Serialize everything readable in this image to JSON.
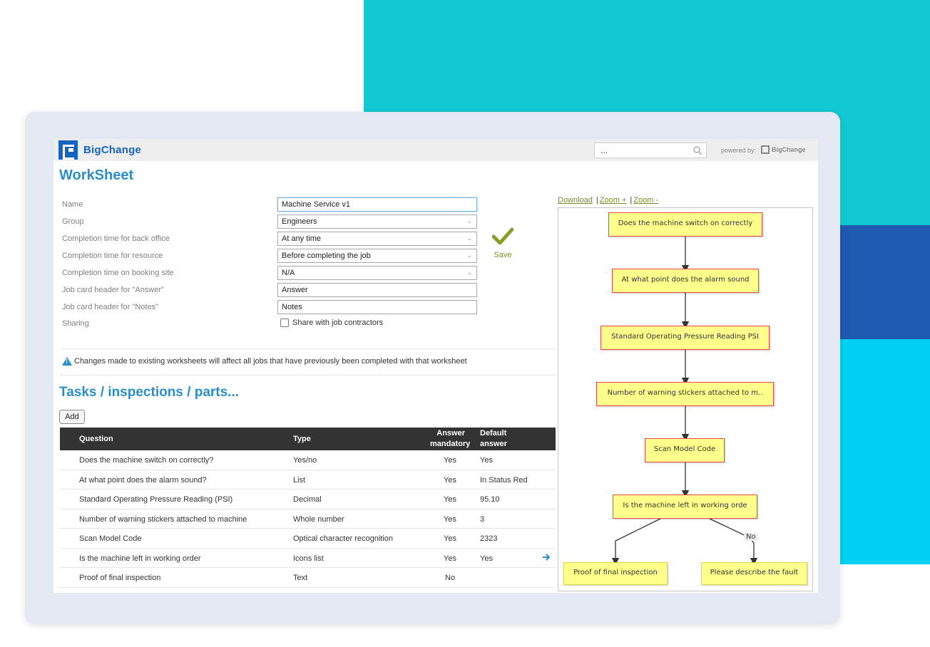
{
  "brand": {
    "name": "BigChange",
    "powered_by": "powered by:",
    "powered_brand": "BigChange"
  },
  "search": {
    "value": "..."
  },
  "page_title": "WorkSheet",
  "form": {
    "name_label": "Name",
    "name_value": "Machine Service v1",
    "group_label": "Group",
    "group_value": "Engineers",
    "ct_back_label": "Completion time for back office",
    "ct_back_value": "At any time",
    "ct_res_label": "Completion time for resource",
    "ct_res_value": "Before completing the job",
    "ct_site_label": "Completion time on booking site",
    "ct_site_value": "N/A",
    "jc_answer_label": "Job card header for \"Answer\"",
    "jc_answer_value": "Answer",
    "jc_notes_label": "Job card header for \"Notes\"",
    "jc_notes_value": "Notes",
    "sharing_label": "Sharing",
    "sharing_checkbox": "Share with job contractors"
  },
  "save_label": "Save",
  "warning": "Changes made to existing worksheets will affect all jobs that have previously been completed with that worksheet",
  "section_title": "Tasks / inspections / parts...",
  "add_label": "Add",
  "table": {
    "headers": {
      "question": "Question",
      "type": "Type",
      "mandatory_1": "Answer",
      "mandatory_2": "mandatory",
      "default_1": "Default",
      "default_2": "answer"
    },
    "rows": [
      {
        "question": "Does the machine switch on correctly?",
        "type": "Yes/no",
        "mandatory": "Yes",
        "default": "Yes"
      },
      {
        "question": "At what point does the alarm sound?",
        "type": "List",
        "mandatory": "Yes",
        "default": "In Status Red"
      },
      {
        "question": "Standard Operating Pressure Reading (PSI)",
        "type": "Decimal",
        "mandatory": "Yes",
        "default": "95.10"
      },
      {
        "question": "Number of warning stickers attached to machine",
        "type": "Whole number",
        "mandatory": "Yes",
        "default": "3"
      },
      {
        "question": "Scan Model Code",
        "type": "Optical character recognition",
        "mandatory": "Yes",
        "default": "2323"
      },
      {
        "question": "Is the machine left in working order",
        "type": "Icons list",
        "mandatory": "Yes",
        "default": "Yes"
      },
      {
        "question": "Proof of final inspection",
        "type": "Text",
        "mandatory": "No",
        "default": ""
      }
    ]
  },
  "flow_links": {
    "download": "Download",
    "zoom_in": "Zoom +",
    "zoom_out": "Zoom -",
    "sep": "|"
  },
  "flowchart": {
    "nodes": [
      "Does the machine switch on correctly",
      "At what point does the alarm sound",
      "Standard Operating Pressure Reading PSI",
      "Number of warning stickers attached to m..",
      "Scan Model Code",
      "Is the machine left in working orde",
      "Proof of final inspection",
      "Please describe the fault"
    ],
    "branch_label": "No"
  },
  "colors": {
    "accent": "#2a8fc9",
    "brand": "#1565c0",
    "node_fill": "#ffff8c",
    "node_border": "#e84a4a"
  }
}
